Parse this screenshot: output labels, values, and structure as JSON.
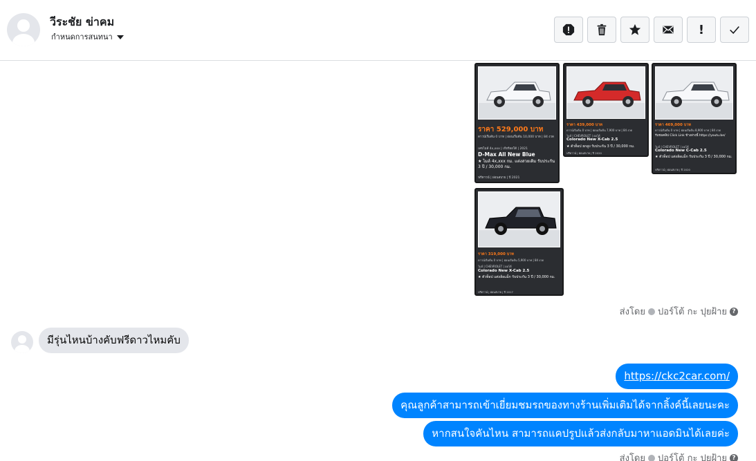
{
  "header": {
    "contact_name": "วีระชัย ข่าคม",
    "conversation_setting": "กำหนดการสนทนา",
    "toolbar": [
      {
        "name": "spam-icon"
      },
      {
        "name": "trash-icon"
      },
      {
        "name": "star-icon"
      },
      {
        "name": "envelope-icon"
      },
      {
        "name": "exclamation-icon",
        "glyph": "!"
      },
      {
        "name": "check-icon"
      }
    ]
  },
  "cards": [
    {
      "price": "ราคา 529,000 บาท",
      "fine": "ดาวน์เริ่มต้น 0 บาท | ผ่อนเริ่มต้น 10,000 บาท | 84 งวด",
      "spec": "เลขไมล์ 4x,xxx | เกียร์ออโต้ | 2021",
      "model": "D-Max All New Blue",
      "feature": "★ ไมล์ 4x,xxx กม. แต่งสวยเดิม รับประกัน 3 ปี / 30,000 กม.",
      "meta": "ฟรีดาวน์ | ผ่อนสบาย | ปี 2021",
      "body_color": "#f2f3f5"
    },
    {
      "price": "ราคา 439,000 บาท",
      "fine": "ดาวน์เริ่มต้น 0 บาท | ผ่อนเริ่มต้น 7,900 บาท | 84 งวด",
      "spec": "ไมล์ | CHEVROLET | ออโต้",
      "model": "Colorado New X-Cab 2.5",
      "feature": "★ ตัวท็อป ยกสูง รับประกัน 3 ปี / 30,000 กม.",
      "meta": "ฟรีดาวน์ | ผ่อนสบาย | ปี 2020",
      "body_color": "#d42a2a"
    },
    {
      "price": "ราคา 469,000 บาท",
      "fine": "ดาวน์เริ่มต้น 0 บาท | ผ่อนเริ่มต้น 8,900 บาท | 84 งวด",
      "link_line": "รับชมคลิป Click Link ข้างล่างนี้ https://youtu.be/",
      "spec": "ไมล์ | CHEVROLET | ออโต้",
      "model": "Colorado New C-Cab 2.5",
      "feature": "★ ตัวท็อป แต่งล้อแม็ก รับประกัน 3 ปี / 30,000 กม.",
      "meta": "ฟรีดาวน์ | ผ่อนสบาย | ปี 2020",
      "body_color": "#f4f5f7"
    },
    {
      "price": "ราคา 319,000 บาท",
      "fine": "ดาวน์เริ่มต้น 0 บาท | ผ่อนเริ่มต้น 5,900 บาท | 84 งวด",
      "spec": "ไมล์ | CHEVROLET | ออโต้",
      "model": "Colorado New X-Cab 2.5",
      "feature": "★ ตัวท็อป แต่งล้อแม็ก รับประกัน 3 ปี / 30,000 กม.",
      "meta": "ฟรีดาวน์ | ผ่อนสบาย | ปี 2017",
      "body_color": "#1f2128"
    }
  ],
  "sent_by": {
    "prefix": "ส่งโดย",
    "name": "ปอร์โต้ กะ ปุยฝ้าย",
    "help": "?"
  },
  "messages": {
    "incoming": "มีรุ่นไหนบ้างคับฟรีดาวไหมคับ",
    "outgoing": [
      "https://ckc2car.com/",
      "คุณลูกค้าสามารถเข้าเยี่ยมชมรถของทางร้านเพิ่มเติมได้จากลิ้งค์นี้เลยนะคะ",
      "หากสนใจคันไหน สามารถแคปรูปแล้วส่งกลับมาหาแอดมินได้เลยค่ะ"
    ]
  },
  "colors": {
    "outgoing_bubble": "#0084ff",
    "incoming_bubble": "#e4e6eb",
    "card_bg": "#2b2d31",
    "price_accent": "#ff7a1a"
  }
}
